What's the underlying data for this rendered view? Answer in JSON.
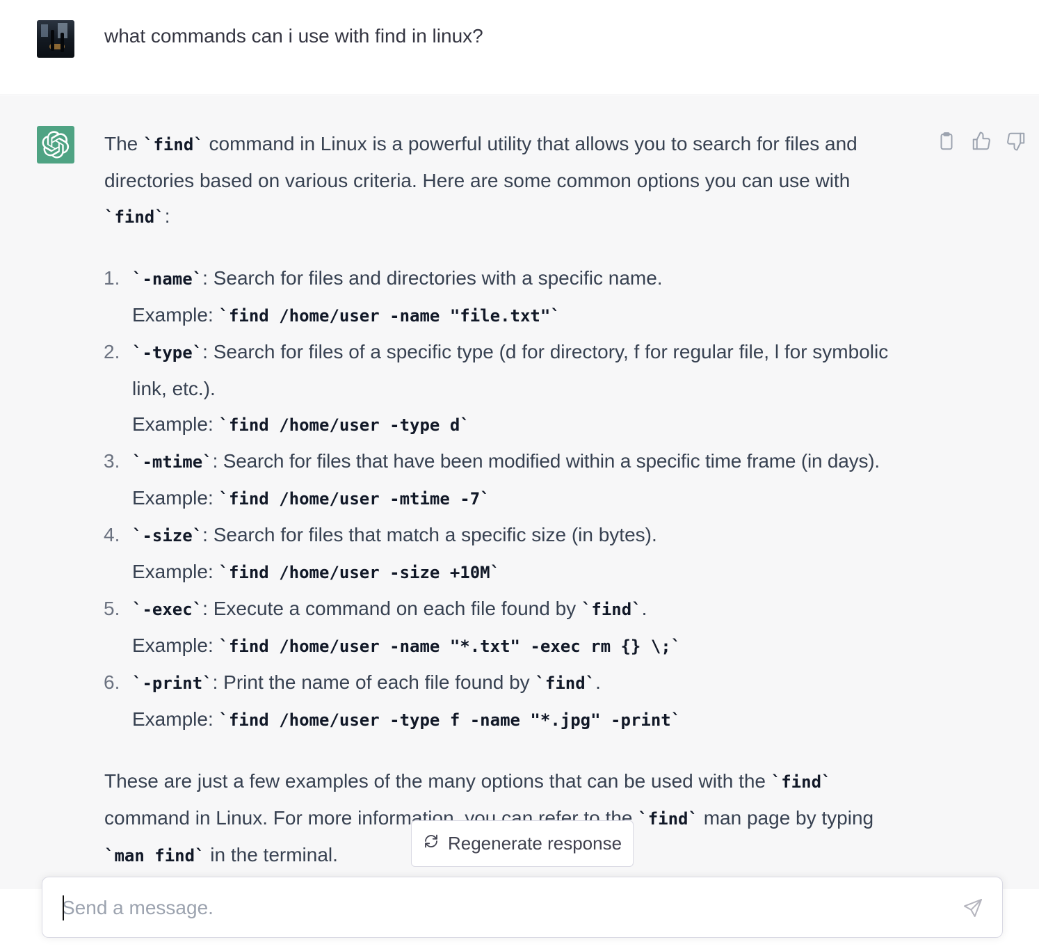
{
  "user": {
    "message": "what commands can i use with find in linux?"
  },
  "assistant": {
    "intro_pre": "The ",
    "intro_code": "`find`",
    "intro_post": " command in Linux is a powerful utility that allows you to search for files and directories based on various criteria. Here are some common options you can use with ",
    "intro_code2": "`find`",
    "intro_end": ":",
    "items": [
      {
        "num": "1.",
        "flag": "`-name`",
        "desc": ": Search for files and directories with a specific name.",
        "example_label": "Example: ",
        "example_code": "`find /home/user -name \"file.txt\"`"
      },
      {
        "num": "2.",
        "flag": "`-type`",
        "desc": ": Search for files of a specific type (d for directory, f for regular file, l for symbolic link, etc.).",
        "example_label": "Example: ",
        "example_code": "`find /home/user -type d`"
      },
      {
        "num": "3.",
        "flag": "`-mtime`",
        "desc": ": Search for files that have been modified within a specific time frame (in days).",
        "example_label": "Example: ",
        "example_code": "`find /home/user -mtime -7`"
      },
      {
        "num": "4.",
        "flag": "`-size`",
        "desc": ": Search for files that match a specific size (in bytes).",
        "example_label": "Example: ",
        "example_code": "`find /home/user -size +10M`"
      },
      {
        "num": "5.",
        "flag": "`-exec`",
        "desc": ": Execute a command on each file found by ",
        "desc_code": "`find`",
        "desc_end": ".",
        "example_label": "Example: ",
        "example_code": "`find /home/user -name \"*.txt\" -exec rm {} \\;`"
      },
      {
        "num": "6.",
        "flag": "`-print`",
        "desc": ": Print the name of each file found by ",
        "desc_code": "`find`",
        "desc_end": ".",
        "example_label": "Example: ",
        "example_code": "`find /home/user -type f -name \"*.jpg\" -print`"
      }
    ],
    "outro_1": "These are just a few examples of the many options that can be used with the ",
    "outro_code1": "`find`",
    "outro_2": " command in Linux. For more information, you can refer to the ",
    "outro_code2": "`find`",
    "outro_3": " man page by typing ",
    "outro_code3": "`man find`",
    "outro_4": " in the terminal."
  },
  "actions": {
    "copy_icon": "clipboard-icon",
    "like_icon": "thumbs-up-icon",
    "dislike_icon": "thumbs-down-icon"
  },
  "regenerate": {
    "label": "Regenerate response",
    "icon": "refresh-icon"
  },
  "composer": {
    "placeholder": "Send a message.",
    "value": "",
    "send_icon": "send-icon"
  },
  "colors": {
    "gpt_brand": "#4fa383",
    "assistant_bg": "#f7f7f8",
    "text": "#374151"
  }
}
